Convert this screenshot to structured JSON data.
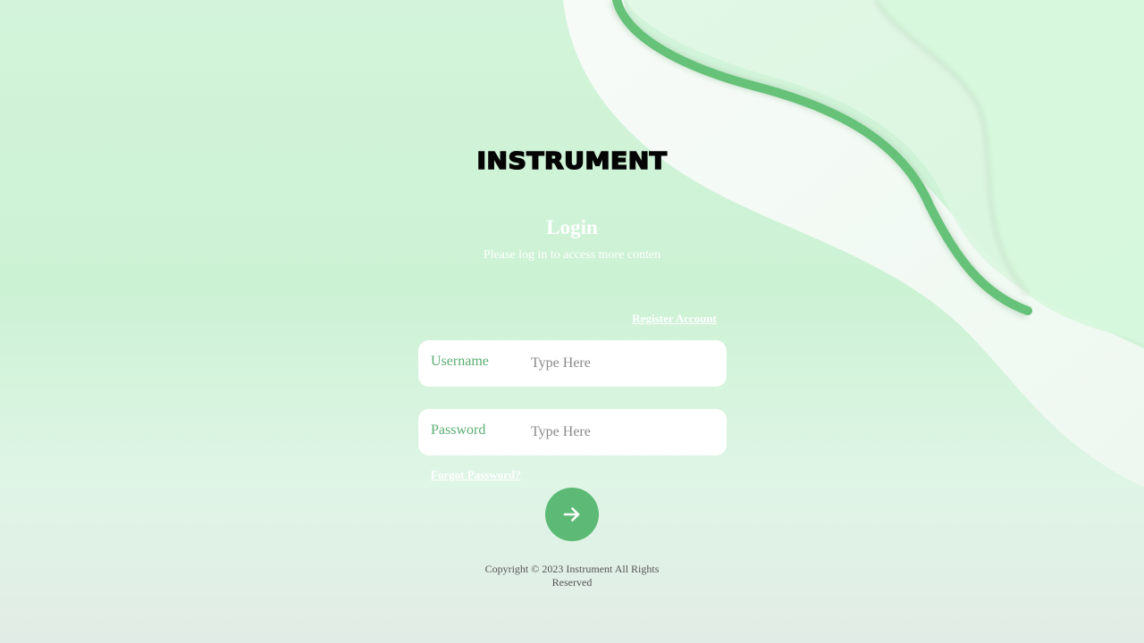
{
  "brand": {
    "logo_text": "INSTRUMENT"
  },
  "header": {
    "title": "Login",
    "subtitle": "Please log in to access more conten"
  },
  "links": {
    "register": "Register Account",
    "forgot_password": "Forgot Password?"
  },
  "form": {
    "username": {
      "label": "Username",
      "value": "",
      "placeholder": "Type Here"
    },
    "password": {
      "label": "Password",
      "value": "",
      "placeholder": "Type Here"
    },
    "submit_icon": "arrow-right-icon"
  },
  "footer": {
    "copyright": "Copyright © 2023 Instrument All Rights Reserved"
  },
  "colors": {
    "accent": "#5cba76",
    "label_green": "#5aae72",
    "background": "#ccf2d4",
    "ribbon_green": "#66c278"
  }
}
